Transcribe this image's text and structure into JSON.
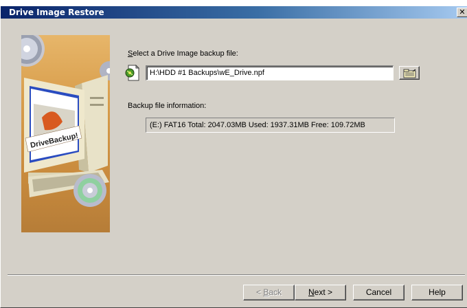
{
  "window": {
    "title": "Drive Image Restore",
    "close_glyph": "✕"
  },
  "illustration": {
    "label": "DriveBackup!"
  },
  "backup_file": {
    "label_accel": "S",
    "label_rest": "elect a Drive Image backup file:",
    "value": "H:\\HDD #1 Backups\\wE_Drive.npf",
    "icon": "disk-file-icon",
    "browse_icon": "folder-browse-icon"
  },
  "info": {
    "label": "Backup file information:",
    "value": "(E:) FAT16 Total: 2047.03MB Used: 1937.31MB Free: 109.72MB"
  },
  "buttons": {
    "back_prefix": "< ",
    "back_accel": "B",
    "back_rest": "ack",
    "next_accel": "N",
    "next_rest": "ext >",
    "cancel": "Cancel",
    "help": "Help"
  },
  "colors": {
    "titlebar_start": "#0a246a",
    "titlebar_end": "#a6caf0",
    "face": "#d4d0c8"
  }
}
